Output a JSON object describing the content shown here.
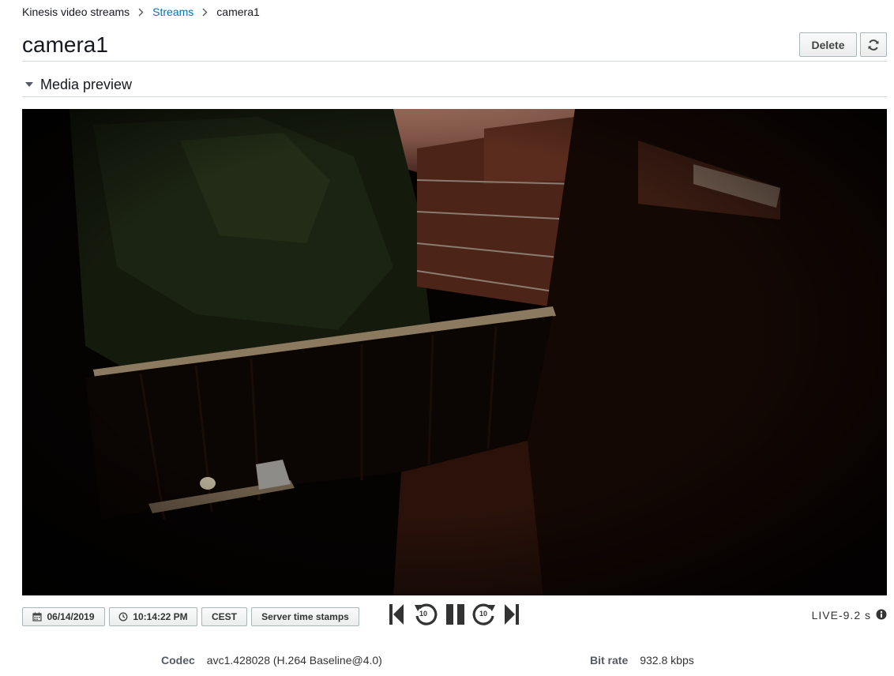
{
  "breadcrumb": {
    "root": "Kinesis video streams",
    "parent": "Streams",
    "current": "camera1"
  },
  "header": {
    "title": "camera1",
    "delete_label": "Delete",
    "refresh_icon": "refresh-icon"
  },
  "media_preview": {
    "title": "Media preview",
    "toggle_icon": "caret-down-icon"
  },
  "controls": {
    "date": "06/14/2019",
    "time": "10:14:22 PM",
    "timezone": "CEST",
    "timestamps_label": "Server time stamps",
    "rewind_seconds": "10",
    "forward_seconds": "10",
    "live_label": "LIVE",
    "live_offset": "-9.2 s"
  },
  "stream_details": {
    "codec_label": "Codec",
    "codec_value": "avc1.428028 (H.264 Baseline@4.0)",
    "bitrate_label": "Bit rate",
    "bitrate_value": "932.8 kbps"
  },
  "colors": {
    "link": "#0073bb",
    "border": "#d5dbdb",
    "text": "#16191f"
  }
}
